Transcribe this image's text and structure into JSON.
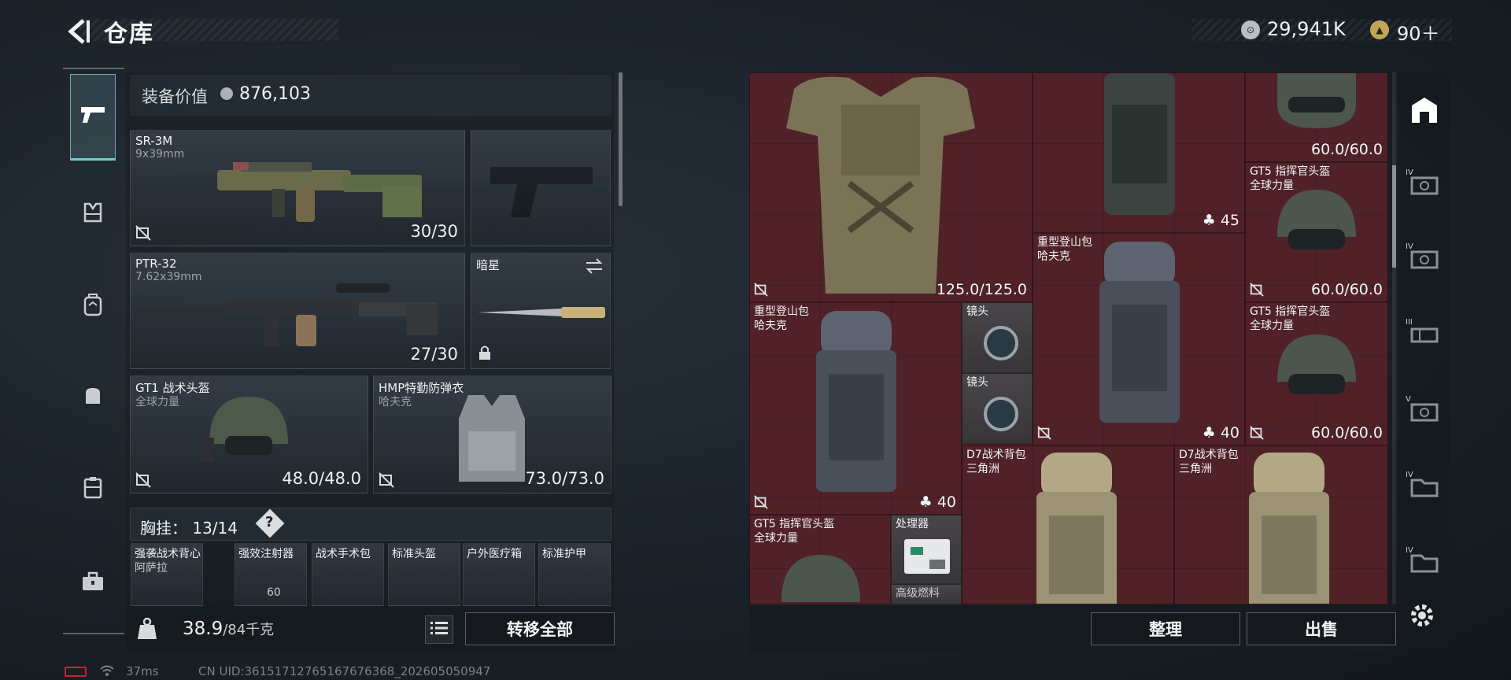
{
  "header": {
    "title": "仓库",
    "currency_1": "29,941K",
    "currency_2": "90＋"
  },
  "left_rail": {
    "items": [
      "weapon",
      "vest",
      "backpack",
      "pouch",
      "container",
      "toolbox"
    ]
  },
  "loadout": {
    "value_label": "装备价值",
    "value": "876,103",
    "primary": {
      "name": "SR-3M",
      "sub": "9x39mm",
      "ammo": "30/30"
    },
    "secondary": {
      "name": "PTR-32",
      "sub": "7.62x39mm",
      "ammo": "27/30"
    },
    "melee": {
      "name": "暗星"
    },
    "helmet": {
      "name": "GT1 战术头盔",
      "sub": "全球力量",
      "durability": "48.0/48.0"
    },
    "armor": {
      "name": "HMP特勤防弹衣",
      "sub": "哈夫克",
      "durability": "73.0/73.0"
    },
    "rig_label": "胸挂：",
    "rig_count": "13/14",
    "rig_help": "?",
    "rig_items": [
      {
        "name": "强袭战术背心",
        "sub": "阿萨拉"
      },
      {
        "name": "强效注射器",
        "sub": "60"
      },
      {
        "name": "战术手术包",
        "sub": ""
      },
      {
        "name": "标准头盔",
        "sub": ""
      },
      {
        "name": "户外医疗箱",
        "sub": ""
      },
      {
        "name": "标准护甲",
        "sub": ""
      }
    ],
    "weight": "38.9",
    "weight_max": "/84千克",
    "transfer_all": "转移全部"
  },
  "stash": {
    "items": [
      {
        "id": "armor-big",
        "name": "",
        "sub": "",
        "value": "125.0/125.0"
      },
      {
        "id": "backpack-top",
        "name": "",
        "sub": "",
        "value": "45"
      },
      {
        "id": "helmet-top",
        "name": "",
        "sub": "",
        "value": "60.0/60.0"
      },
      {
        "id": "helmet-2",
        "name": "GT5 指挥官头盔",
        "sub": "全球力量",
        "value": "60.0/60.0"
      },
      {
        "id": "backpack-mid",
        "name": "重型登山包",
        "sub": "哈夫克",
        "value": "40"
      },
      {
        "id": "helmet-3",
        "name": "GT5 指挥官头盔",
        "sub": "全球力量",
        "value": "60.0/60.0"
      },
      {
        "id": "backpack-left",
        "name": "重型登山包",
        "sub": "哈夫克",
        "value": "40"
      },
      {
        "id": "scope-1",
        "name": "镜头",
        "sub": "",
        "value": ""
      },
      {
        "id": "scope-2",
        "name": "镜头",
        "sub": "",
        "value": ""
      },
      {
        "id": "d7-1",
        "name": "D7战术背包",
        "sub": "三角洲",
        "value": ""
      },
      {
        "id": "d7-2",
        "name": "D7战术背包",
        "sub": "三角洲",
        "value": ""
      },
      {
        "id": "helmet-4",
        "name": "GT5 指挥官头盔",
        "sub": "全球力量",
        "value": ""
      },
      {
        "id": "processor",
        "name": "处理器",
        "sub": "",
        "value": ""
      },
      {
        "id": "fuel",
        "name": "高级燃料",
        "sub": "",
        "value": ""
      }
    ],
    "sort": "整理",
    "sell": "出售"
  },
  "right_rail": {
    "tiers": [
      "",
      "IV",
      "IV",
      "III",
      "V",
      "IV",
      "IV"
    ]
  },
  "status": {
    "ping": "37ms",
    "uid": "CN UID:36151712765167676368_202605050947"
  },
  "colors": {
    "stash_bg": "#4c1e24",
    "accent": "#6fd0c8"
  }
}
